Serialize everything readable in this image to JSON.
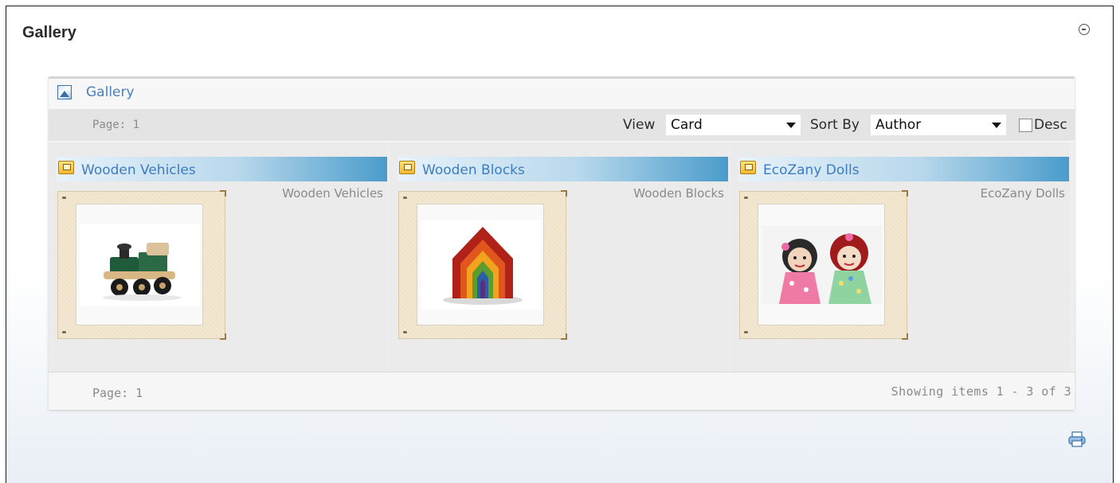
{
  "module": {
    "title": "Gallery"
  },
  "gallery": {
    "header_link": "Gallery",
    "page_label_top": "Page: 1",
    "view_label": "View",
    "view_value": "Card",
    "sort_label": "Sort By",
    "sort_value": "Author",
    "desc_label": "Desc",
    "desc_checked": false,
    "cards": [
      {
        "title": "Wooden Vehicles",
        "caption": "Wooden Vehicles",
        "image": "wooden-train-toy"
      },
      {
        "title": "Wooden Blocks",
        "caption": "Wooden Blocks",
        "image": "rainbow-stacking-house"
      },
      {
        "title": "EcoZany Dolls",
        "caption": "EcoZany Dolls",
        "image": "rag-dolls"
      }
    ],
    "page_label_bottom": "Page: 1",
    "showing_text": "Showing items 1 - 3 of 3"
  },
  "icons": [
    "collapse-icon",
    "gallery-icon",
    "album-icon",
    "print-icon"
  ],
  "colors": {
    "link": "#4a7fc0",
    "card_bar_end": "#4a9ccb",
    "border": "#1a1a1a"
  }
}
